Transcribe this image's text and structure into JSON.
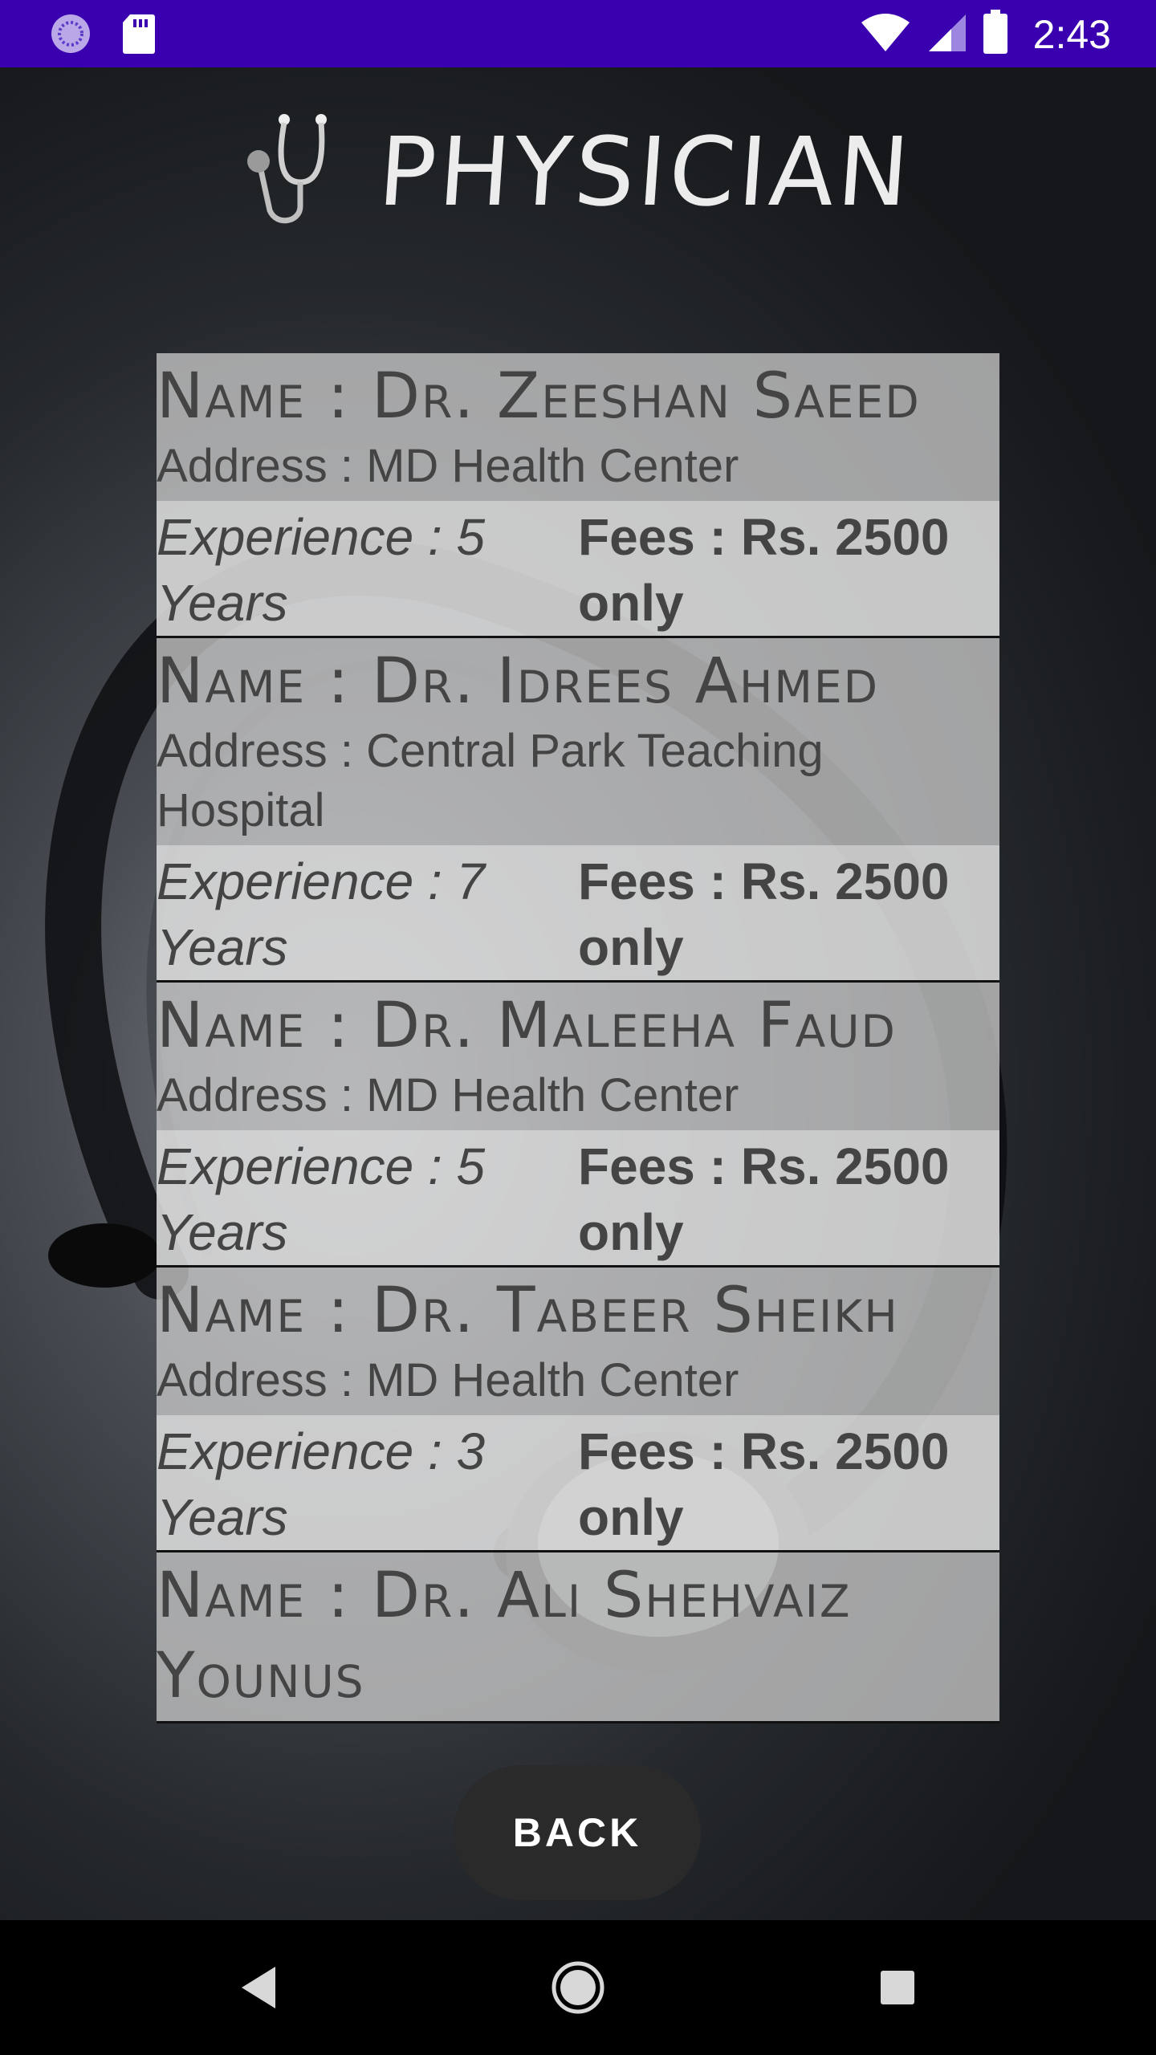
{
  "status_bar": {
    "time": "2:43",
    "icons": [
      "loading-icon",
      "sd-card-icon",
      "wifi-icon",
      "signal-icon",
      "battery-icon"
    ]
  },
  "header": {
    "icon": "stethoscope-icon",
    "title": "PHYSICIAN"
  },
  "doctors": [
    {
      "name": "Name : Dr. Zeeshan Saeed",
      "address": "Address : MD Health Center",
      "experience_line1": "Experience : 5",
      "experience_line2": "Years",
      "fees_line1": "Fees : Rs. 2500",
      "fees_line2": "only"
    },
    {
      "name": "Name : Dr. Idrees Ahmed",
      "address": "Address : Central Park Teaching Hospital",
      "experience_line1": "Experience : 7",
      "experience_line2": "Years",
      "fees_line1": "Fees : Rs. 2500",
      "fees_line2": "only"
    },
    {
      "name": "Name : Dr. Maleeha Faud",
      "address": "Address : MD Health Center",
      "experience_line1": "Experience : 5",
      "experience_line2": "Years",
      "fees_line1": "Fees : Rs. 2500",
      "fees_line2": "only"
    },
    {
      "name": "Name : Dr. Tabeer Sheikh",
      "address": "Address : MD Health Center",
      "experience_line1": "Experience : 3",
      "experience_line2": "Years",
      "fees_line1": "Fees : Rs. 2500",
      "fees_line2": "only"
    },
    {
      "name": "Name : Dr. Ali Shehvaiz Younus"
    }
  ],
  "back_button": {
    "label": "BACK"
  },
  "nav_bar": {
    "icons": [
      "back-triangle-icon",
      "home-circle-icon",
      "recents-square-icon"
    ]
  },
  "colors": {
    "status_bar": "#3a00b0",
    "card_top": "#c8c8c8",
    "card_bottom": "#dedede",
    "text": "#444444",
    "back_button": "#2a2a2a"
  }
}
